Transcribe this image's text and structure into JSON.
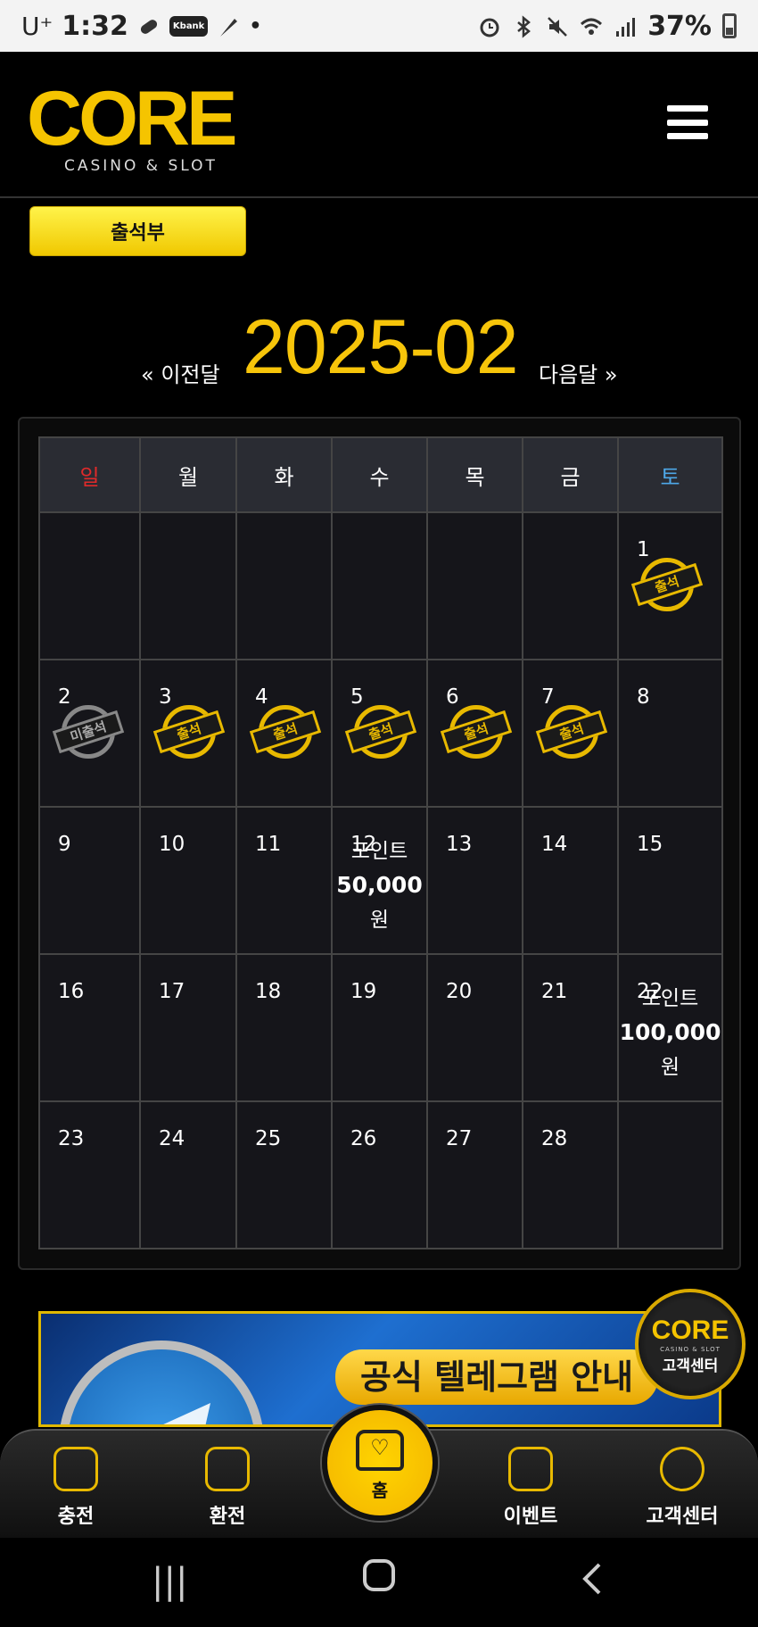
{
  "status_bar": {
    "carrier": "U⁺",
    "time": "1:32",
    "app_icon_label": "Kbank",
    "battery": "37%"
  },
  "header": {
    "logo_text": "CORE",
    "logo_sub": "CASINO & SLOT"
  },
  "attendance_button": "출석부",
  "month_nav": {
    "prev": "« 이전달",
    "title": "2025-02",
    "next": "다음달 »"
  },
  "calendar": {
    "weekdays": [
      "일",
      "월",
      "화",
      "수",
      "목",
      "금",
      "토"
    ],
    "stamp_attended": "출석",
    "stamp_missed": "미출석",
    "point_word": "포인트",
    "point_unit": "원",
    "rows": [
      [
        "",
        "",
        "",
        "",
        "",
        "",
        "1"
      ],
      [
        "2",
        "3",
        "4",
        "5",
        "6",
        "7",
        "8"
      ],
      [
        "9",
        "10",
        "11",
        "12",
        "13",
        "14",
        "15"
      ],
      [
        "16",
        "17",
        "18",
        "19",
        "20",
        "21",
        "22"
      ],
      [
        "23",
        "24",
        "25",
        "26",
        "27",
        "28",
        ""
      ]
    ],
    "point_12": "50,000",
    "point_22": "100,000"
  },
  "banner": {
    "label": "공식 텔레그램 안내"
  },
  "cs_badge": {
    "logo": "CORE",
    "sub": "CASINO & SLOT",
    "label": "고객센터"
  },
  "bottom_nav": {
    "items": [
      {
        "label": "충전"
      },
      {
        "label": "환전"
      },
      {
        "label": "홈"
      },
      {
        "label": "이벤트"
      },
      {
        "label": "고객센터"
      }
    ]
  },
  "colors": {
    "accent": "#f7c50a",
    "sunday": "#e02a2a",
    "saturday": "#4ea8e8"
  }
}
